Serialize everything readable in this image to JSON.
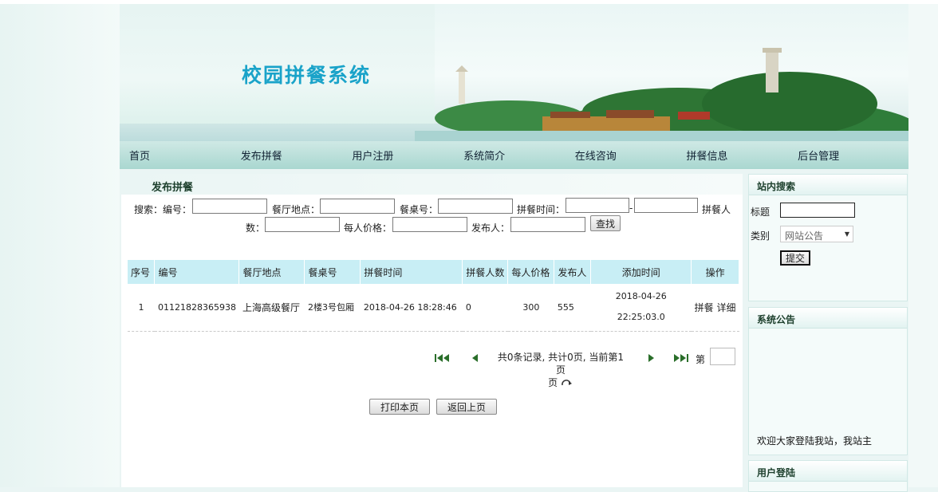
{
  "site": {
    "title": "校园拼餐系统"
  },
  "nav": [
    "首页",
    "发布拼餐",
    "用户注册",
    "系统简介",
    "在线咨询",
    "拼餐信息",
    "后台管理"
  ],
  "section": {
    "title": "发布拼餐"
  },
  "search": {
    "prefix": "搜索：",
    "fields": {
      "id": "编号：",
      "location": "餐厅地点：",
      "table": "餐桌号：",
      "time": "拼餐时间：",
      "time_sep": "-",
      "people_a": "拼餐人",
      "people_b": "数：",
      "price": "每人价格：",
      "publisher": "发布人："
    },
    "button": "查找"
  },
  "table": {
    "headers": [
      "序号",
      "编号",
      "餐厅地点",
      "餐桌号",
      "拼餐时间",
      "拼餐人数",
      "每人价格",
      "发布人",
      "添加时间",
      "操作"
    ],
    "rows": [
      {
        "no": "1",
        "id": "01121828365938",
        "location": "上海高级餐厅",
        "table": "2楼3号包厢",
        "time": "2018-04-26 18:28:46",
        "people": "0",
        "price": "300",
        "publisher": "555",
        "added_date": "2018-04-26",
        "added_time": "22:25:03.0",
        "action_join": "拼餐",
        "action_detail": "详细"
      }
    ]
  },
  "pager": {
    "info_line1": "共0条记录, 共计0页, 当前第1页",
    "info_line2": "页",
    "di": "第"
  },
  "actions": {
    "print": "打印本页",
    "back": "返回上页"
  },
  "sidebar": {
    "search_title": "站内搜索",
    "title_label": "标题",
    "category_label": "类别",
    "category_value": "网站公告",
    "submit": "提交",
    "notice_title": "系统公告",
    "notice_text": "欢迎大家登陆我站，我站主",
    "login_title": "用户登陆"
  }
}
